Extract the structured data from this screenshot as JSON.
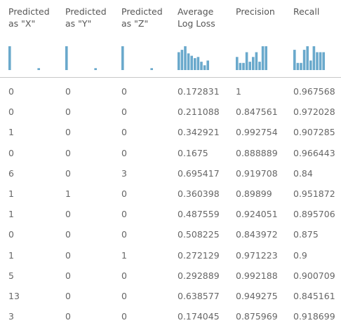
{
  "colors": {
    "bar": "#6aa9cc",
    "divider": "#c8c8c8",
    "text": "#666666"
  },
  "columns": [
    {
      "key": "pred_x",
      "label": "Predicted\nas \"X\"",
      "histogram": [
        1,
        0,
        0,
        0,
        0,
        0,
        0,
        0,
        0,
        0.08
      ]
    },
    {
      "key": "pred_y",
      "label": "Predicted\nas \"Y\"",
      "histogram": [
        1,
        0,
        0,
        0,
        0,
        0,
        0,
        0,
        0,
        0.08
      ]
    },
    {
      "key": "pred_z",
      "label": "Predicted\nas \"Z\"",
      "histogram": [
        1,
        0,
        0,
        0,
        0,
        0,
        0,
        0,
        0,
        0.08
      ]
    },
    {
      "key": "avg_log_loss",
      "label": "Average\nLog Loss",
      "histogram": [
        0.75,
        0.85,
        1,
        0.7,
        0.6,
        0.5,
        0.55,
        0.35,
        0.2,
        0.4
      ]
    },
    {
      "key": "precision",
      "label": "Precision",
      "histogram": [
        0.55,
        0.3,
        0.3,
        0.75,
        0.35,
        0.55,
        0.75,
        0.35,
        1,
        1
      ]
    },
    {
      "key": "recall",
      "label": "Recall",
      "histogram": [
        0.85,
        0.3,
        0.3,
        0.85,
        1,
        0.4,
        1,
        0.75,
        0.75,
        0.75
      ]
    }
  ],
  "rows": [
    [
      "0",
      "0",
      "0",
      "0.172831",
      "1",
      "0.967568"
    ],
    [
      "0",
      "0",
      "0",
      "0.211088",
      "0.847561",
      "0.972028"
    ],
    [
      "1",
      "0",
      "0",
      "0.342921",
      "0.992754",
      "0.907285"
    ],
    [
      "0",
      "0",
      "0",
      "0.1675",
      "0.888889",
      "0.966443"
    ],
    [
      "6",
      "0",
      "3",
      "0.695417",
      "0.919708",
      "0.84"
    ],
    [
      "1",
      "1",
      "0",
      "0.360398",
      "0.89899",
      "0.951872"
    ],
    [
      "1",
      "0",
      "0",
      "0.487559",
      "0.924051",
      "0.895706"
    ],
    [
      "0",
      "0",
      "0",
      "0.508225",
      "0.843972",
      "0.875"
    ],
    [
      "1",
      "0",
      "1",
      "0.272129",
      "0.971223",
      "0.9"
    ],
    [
      "5",
      "0",
      "0",
      "0.292889",
      "0.992188",
      "0.900709"
    ],
    [
      "13",
      "0",
      "0",
      "0.638577",
      "0.949275",
      "0.845161"
    ],
    [
      "3",
      "0",
      "0",
      "0.174045",
      "0.875969",
      "0.918699"
    ]
  ]
}
